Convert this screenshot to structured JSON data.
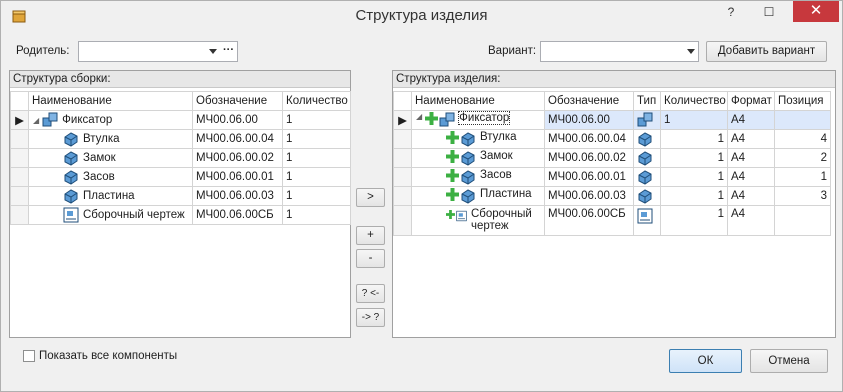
{
  "window": {
    "title": "Структура изделия"
  },
  "toolbar": {
    "parent_label": "Родитель:",
    "parent_value": "",
    "ellipsis": "···",
    "variant_label": "Вариант:",
    "variant_value": "",
    "add_variant": "Добавить вариант"
  },
  "left": {
    "title": "Структура сборки:",
    "headers": [
      "Наименование",
      "Обозначение",
      "Количество"
    ],
    "rows": [
      {
        "name": "Фиксатор",
        "code": "МЧ00.06.00",
        "qty": "1",
        "icon": "assembly-icon"
      },
      {
        "name": "Втулка",
        "code": "МЧ00.06.00.04",
        "qty": "1",
        "icon": "part-icon"
      },
      {
        "name": "Замок",
        "code": "МЧ00.06.00.02",
        "qty": "1",
        "icon": "part-icon"
      },
      {
        "name": "Засов",
        "code": "МЧ00.06.00.01",
        "qty": "1",
        "icon": "part-icon"
      },
      {
        "name": "Пластина",
        "code": "МЧ00.06.00.03",
        "qty": "1",
        "icon": "part-icon"
      },
      {
        "name": "Сборочный чертеж",
        "code": "МЧ00.06.00СБ",
        "qty": "1",
        "icon": "drawing-icon"
      }
    ]
  },
  "mid": {
    "move": ">",
    "plus": "+",
    "minus": "-",
    "q_left": "? <-",
    "q_right": "-> ?"
  },
  "right": {
    "title": "Структура изделия:",
    "headers": [
      "Наименование",
      "Обозначение",
      "Тип",
      "Количество",
      "Формат",
      "Позиция"
    ],
    "rows": [
      {
        "name": "Фиксатор",
        "code": "МЧ00.06.00",
        "qty": "1",
        "format": "А4",
        "pos": "",
        "icon": "assembly-icon"
      },
      {
        "name": "Втулка",
        "code": "МЧ00.06.00.04",
        "qty": "1",
        "format": "А4",
        "pos": "4",
        "icon": "part-icon"
      },
      {
        "name": "Замок",
        "code": "МЧ00.06.00.02",
        "qty": "1",
        "format": "А4",
        "pos": "2",
        "icon": "part-icon"
      },
      {
        "name": "Засов",
        "code": "МЧ00.06.00.01",
        "qty": "1",
        "format": "А4",
        "pos": "1",
        "icon": "part-icon"
      },
      {
        "name": "Пластина",
        "code": "МЧ00.06.00.03",
        "qty": "1",
        "format": "А4",
        "pos": "3",
        "icon": "part-icon"
      },
      {
        "name": "Сборочный чертеж",
        "code": "МЧ00.06.00СБ",
        "qty": "1",
        "format": "А4",
        "pos": "",
        "icon": "drawing-icon"
      }
    ]
  },
  "footer": {
    "show_all": "Показать все компоненты",
    "ok": "ОК",
    "cancel": "Отмена"
  },
  "colors": {
    "accent": "#3a7bd5",
    "close": "#c7383d",
    "plus": "#3cb043"
  }
}
